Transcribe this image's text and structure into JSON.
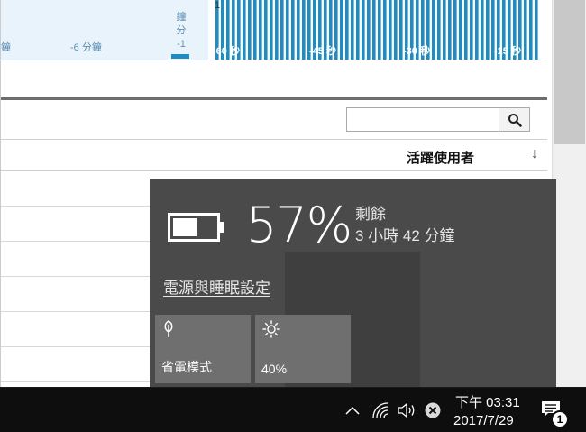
{
  "chart": {
    "left_labels": [
      "鐘",
      "-6 分鐘"
    ],
    "vertical_tick": "鐘\n分\n-1",
    "top_value": "1",
    "axis_labels": [
      "-60 秒",
      "-45 秒",
      "-30 秒",
      "-15 秒"
    ],
    "bar_color": "#1e8bc3"
  },
  "table": {
    "header_active_users": "活躍使用者",
    "sort_arrow": "↓"
  },
  "flyout": {
    "battery_percent": "57%",
    "battery_level": 0.57,
    "remaining_label": "剩餘",
    "remaining_time": "3 小時 42 分鐘",
    "settings_link": "電源與睡眠設定",
    "tiles": [
      {
        "label": "省電模式",
        "icon": "leaf-icon"
      },
      {
        "label": "40%",
        "icon": "brightness-icon"
      }
    ]
  },
  "taskbar": {
    "time": "下午 03:31",
    "date": "2017/7/29",
    "notification_count": "1",
    "icons": [
      "chevron-up-icon",
      "wifi-icon",
      "volume-icon",
      "battery-error-icon",
      "notification-icon"
    ]
  }
}
